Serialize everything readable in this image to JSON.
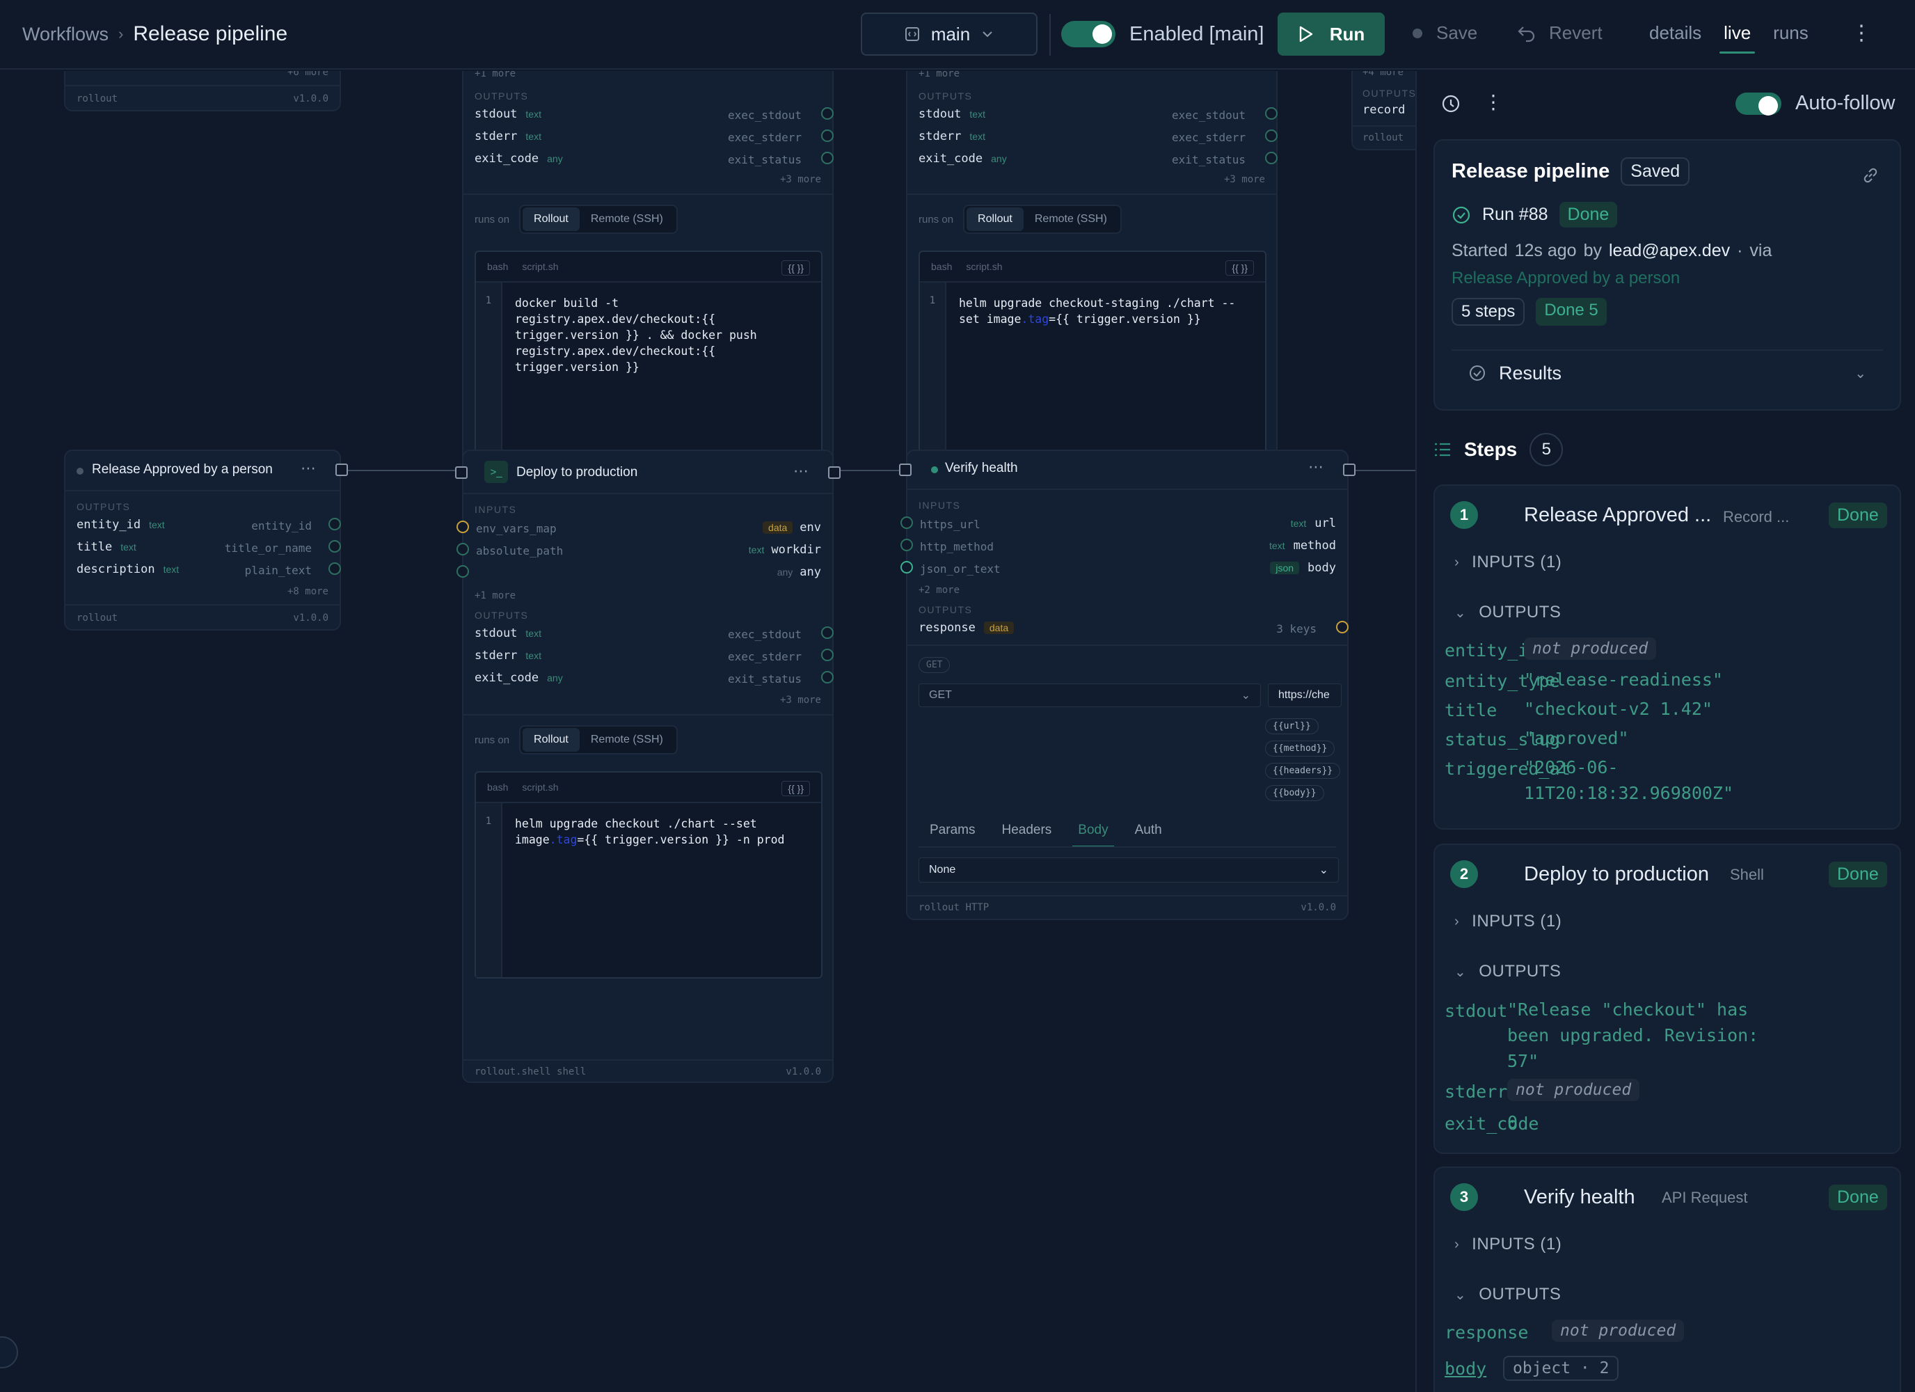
{
  "header": {
    "breadcrumb_root": "Workflows",
    "breadcrumb_current": "Release pipeline",
    "branch": "main",
    "enabled_label": "Enabled [main]",
    "run_label": "Run",
    "save_label": "Save",
    "revert_label": "Revert",
    "tabs": [
      "details",
      "live",
      "runs"
    ],
    "active_tab": "live"
  },
  "canvas": {
    "top_left_node": {
      "more": "+6 more",
      "footer_left": "rollout",
      "footer_right": "v1.0.0"
    },
    "build_node": {
      "more_top": "+1 more",
      "outputs_label": "OUTPUTS",
      "outputs": [
        {
          "name": "stdout",
          "type": "text",
          "target": "exec_stdout"
        },
        {
          "name": "stderr",
          "type": "text",
          "target": "exec_stderr"
        },
        {
          "name": "exit_code",
          "type": "any",
          "target": "exit_status"
        }
      ],
      "more_outputs": "+3 more",
      "runs_on": "runs on",
      "runner_options": [
        "Rollout",
        "Remote (SSH)"
      ],
      "editor_lang": "bash",
      "editor_file": "script.sh",
      "editor_braces": "{{ }}",
      "code_line_no": "1",
      "code": "docker build -t registry.apex.dev/checkout:{{ trigger.version }} . && docker push registry.apex.dev/checkout:{{ trigger.version }}"
    },
    "staging_node": {
      "more_top": "+1 more",
      "outputs_label": "OUTPUTS",
      "outputs": [
        {
          "name": "stdout",
          "type": "text",
          "target": "exec_stdout"
        },
        {
          "name": "stderr",
          "type": "text",
          "target": "exec_stderr"
        },
        {
          "name": "exit_code",
          "type": "any",
          "target": "exit_status"
        }
      ],
      "more_outputs": "+3 more",
      "runs_on": "runs on",
      "runner_options": [
        "Rollout",
        "Remote (SSH)"
      ],
      "editor_lang": "bash",
      "editor_file": "script.sh",
      "editor_braces": "{{ }}",
      "code_line_no": "1",
      "code_pre": "helm upgrade checkout-staging ./chart --set image",
      "code_kw": ".tag",
      "code_post": "={{ trigger.version }}"
    },
    "far_right_node": {
      "more": "+4 more",
      "outputs_label": "OUTPUTS",
      "output": "record",
      "footer": "rollout"
    },
    "approval_node": {
      "title": "Release Approved by a person",
      "outputs_label": "OUTPUTS",
      "outputs": [
        {
          "name": "entity_id",
          "type": "text",
          "target": "entity_id"
        },
        {
          "name": "title",
          "type": "text",
          "target": "title_or_name"
        },
        {
          "name": "description",
          "type": "text",
          "target": "plain_text"
        }
      ],
      "more": "+8 more",
      "footer_left": "rollout",
      "footer_right": "v1.0.0"
    },
    "deploy_node": {
      "title": "Deploy to production",
      "inputs_label": "INPUTS",
      "inputs": [
        {
          "name": "env_vars_map",
          "type": "data",
          "target": "env"
        },
        {
          "name": "absolute_path",
          "type": "text",
          "target": "workdir"
        },
        {
          "name": "",
          "type": "any",
          "target": "any"
        }
      ],
      "more_inputs": "+1 more",
      "outputs_label": "OUTPUTS",
      "outputs": [
        {
          "name": "stdout",
          "type": "text",
          "target": "exec_stdout"
        },
        {
          "name": "stderr",
          "type": "text",
          "target": "exec_stderr"
        },
        {
          "name": "exit_code",
          "type": "any",
          "target": "exit_status"
        }
      ],
      "more_outputs": "+3 more",
      "runs_on": "runs on",
      "runner_options": [
        "Rollout",
        "Remote (SSH)"
      ],
      "editor_lang": "bash",
      "editor_file": "script.sh",
      "editor_braces": "{{ }}",
      "code_line_no": "1",
      "code_pre": "helm upgrade checkout ./chart --set image",
      "code_kw": ".tag",
      "code_post": "={{ trigger.version }} -n prod",
      "footer_left": "rollout.shell",
      "footer_type": "shell",
      "footer_right": "v1.0.0"
    },
    "verify_node": {
      "title": "Verify health",
      "inputs_label": "INPUTS",
      "inputs": [
        {
          "name": "https_url",
          "type": "text",
          "target": "url"
        },
        {
          "name": "http_method",
          "type": "text",
          "target": "method"
        },
        {
          "name": "json_or_text",
          "type": "json",
          "target": "body"
        }
      ],
      "more_inputs": "+2 more",
      "outputs_label": "OUTPUTS",
      "output_name": "response",
      "output_type": "data",
      "output_keys": "3 keys",
      "method_chip": "GET",
      "method_select": "GET",
      "url_value": "https://che",
      "template_chips": [
        "{{url}}",
        "{{method}}",
        "{{headers}}",
        "{{body}}"
      ],
      "subtabs": [
        "Params",
        "Headers",
        "Body",
        "Auth"
      ],
      "active_subtab": "Body",
      "body_select": "None",
      "footer_left": "rollout",
      "footer_type": "HTTP",
      "footer_right": "v1.0.0"
    }
  },
  "panel": {
    "auto_follow_label": "Auto-follow",
    "workflow_name": "Release pipeline",
    "saved_badge": "Saved",
    "run_label": "Run #88",
    "run_status": "Done",
    "started_prefix": "Started",
    "started_time": "12s ago",
    "by_label": "by",
    "user": "lead@apex.dev",
    "via_label": "via",
    "trigger": "Release Approved by a person",
    "steps_count_label": "5 steps",
    "done_count_label": "Done 5",
    "results_label": "Results",
    "steps_heading": "Steps",
    "steps_count": "5",
    "steps": [
      {
        "num": "1",
        "title": "Release Approved ...",
        "sub": "Record ...",
        "status": "Done",
        "inputs_label": "INPUTS (1)",
        "outputs_label": "OUTPUTS",
        "outputs": [
          {
            "key": "entity_id",
            "value": "not produced"
          },
          {
            "key": "entity_type",
            "value": "\"release-readiness\""
          },
          {
            "key": "title",
            "value": "\"checkout-v2 1.42\""
          },
          {
            "key": "status_slug",
            "value": "\"approved\""
          },
          {
            "key": "triggered_at",
            "value": "\"2026-06-11T20:18:32.969800Z\""
          }
        ]
      },
      {
        "num": "2",
        "title": "Deploy to production",
        "sub": "Shell",
        "status": "Done",
        "inputs_label": "INPUTS (1)",
        "outputs_label": "OUTPUTS",
        "outputs": [
          {
            "key": "stdout",
            "value": "\"Release \"checkout\" has been upgraded. Revision: 57\""
          },
          {
            "key": "stderr",
            "value": "not produced"
          },
          {
            "key": "exit_code",
            "value": "0"
          }
        ]
      },
      {
        "num": "3",
        "title": "Verify health",
        "sub": "API Request",
        "status": "Done",
        "inputs_label": "INPUTS (1)",
        "outputs_label": "OUTPUTS",
        "outputs": [
          {
            "key": "response",
            "value": "not produced"
          },
          {
            "key": "body",
            "value": "object · 2"
          }
        ]
      }
    ]
  },
  "colors": {
    "accent": "#2d8f78",
    "done": "#3db08f",
    "background": "#0f192a",
    "card": "#132034"
  }
}
